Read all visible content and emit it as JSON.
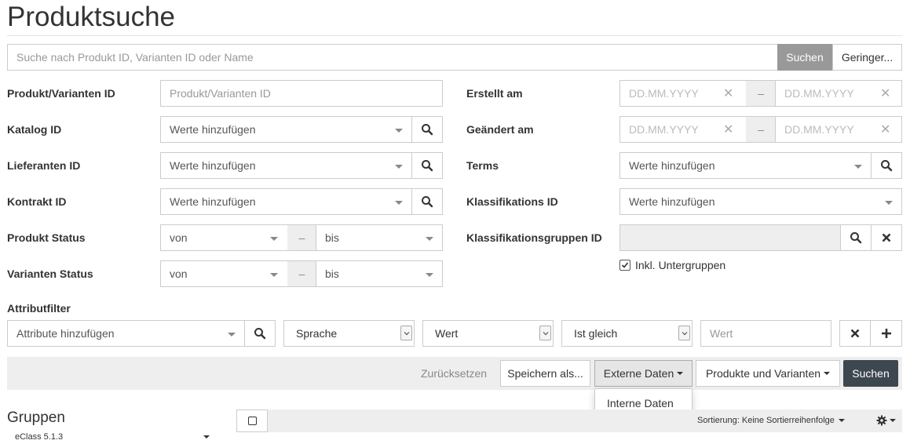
{
  "page": {
    "title": "Produktsuche"
  },
  "search": {
    "placeholder": "Suche nach Produkt ID, Varianten ID oder Name",
    "submit": "Suchen",
    "less": "Geringer..."
  },
  "left_fields": [
    {
      "label": "Produkt/Varianten ID",
      "placeholder": "Produkt/Varianten ID"
    },
    {
      "label": "Katalog ID",
      "placeholder": "Werte hinzufügen"
    },
    {
      "label": "Lieferanten ID",
      "placeholder": "Werte hinzufügen"
    },
    {
      "label": "Kontrakt ID",
      "placeholder": "Werte hinzufügen"
    },
    {
      "label": "Produkt Status",
      "from": "von",
      "sep": "–",
      "to": "bis"
    },
    {
      "label": "Varianten Status",
      "from": "von",
      "sep": "–",
      "to": "bis"
    }
  ],
  "right_fields": [
    {
      "label": "Erstellt am",
      "from": "DD.MM.YYYY",
      "sep": "–",
      "to": "DD.MM.YYYY"
    },
    {
      "label": "Geändert am",
      "from": "DD.MM.YYYY",
      "sep": "–",
      "to": "DD.MM.YYYY"
    },
    {
      "label": "Terms",
      "placeholder": "Werte hinzufügen"
    },
    {
      "label": "Klassifikations ID",
      "placeholder": "Werte hinzufügen"
    },
    {
      "label": "Klassifikationsgruppen ID",
      "placeholder": ""
    }
  ],
  "include_subgroups": {
    "label": "Inkl. Untergruppen",
    "checked": true
  },
  "attribute_filter": {
    "label": "Attributfilter",
    "placeholder": "Attribute hinzufügen",
    "language": "Sprache",
    "value_select": "Wert",
    "operator": "Ist gleich",
    "value_placeholder": "Wert"
  },
  "actions": {
    "reset": "Zurücksetzen",
    "save": "Speichern als...",
    "external": "Externe Daten",
    "products": "Produkte und Varianten",
    "search": "Suchen",
    "dropdown_item": "Interne Daten"
  },
  "groups": {
    "title": "Gruppen",
    "selected": "eClass 5.1.3"
  },
  "results": {
    "sort": "Sortierung: Keine Sortierreihenfolge"
  }
}
